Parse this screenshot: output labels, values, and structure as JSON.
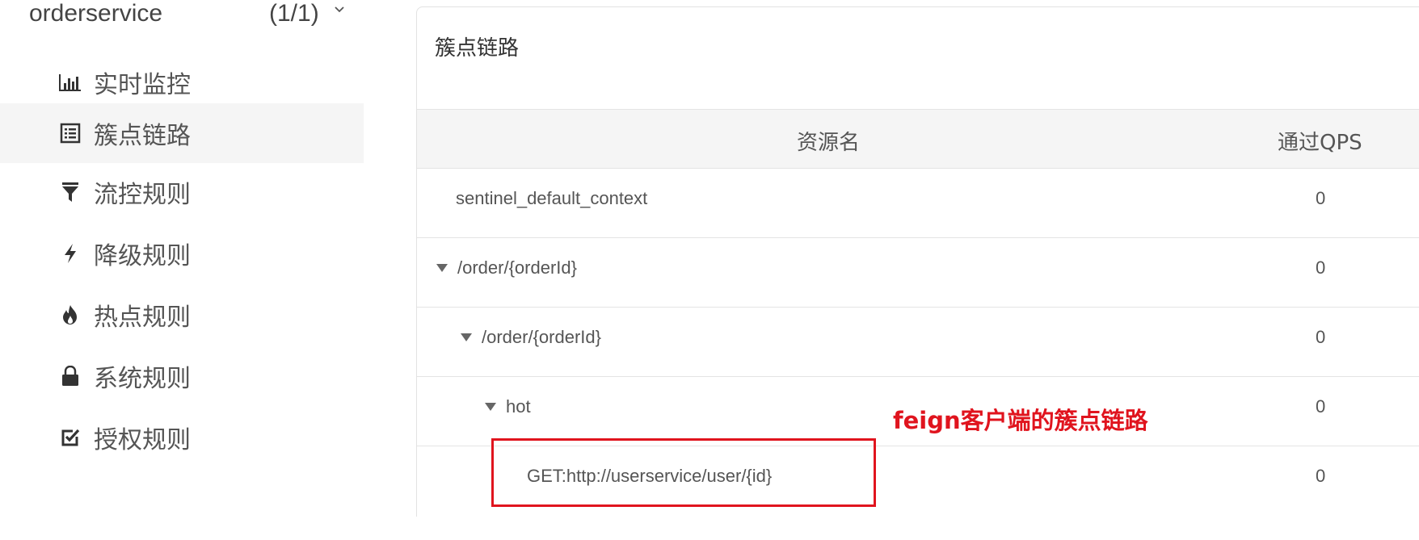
{
  "sidebar": {
    "app_name": "orderservice",
    "app_count": "(1/1)",
    "items": [
      {
        "label": "实时监控",
        "icon": "bar-chart-icon"
      },
      {
        "label": "簇点链路",
        "icon": "list-icon"
      },
      {
        "label": "流控规则",
        "icon": "filter-icon"
      },
      {
        "label": "降级规则",
        "icon": "lightning-icon"
      },
      {
        "label": "热点规则",
        "icon": "fire-icon"
      },
      {
        "label": "系统规则",
        "icon": "lock-icon"
      },
      {
        "label": "授权规则",
        "icon": "check-square-icon"
      }
    ],
    "active_index": 1
  },
  "panel": {
    "title": "簇点链路",
    "columns": {
      "resource": "资源名",
      "qps": "通过QPS"
    },
    "rows": [
      {
        "name": "sentinel_default_context",
        "qps": "0",
        "level": 0,
        "expanded": null
      },
      {
        "name": "/order/{orderId}",
        "qps": "0",
        "level": 1,
        "expanded": true
      },
      {
        "name": "/order/{orderId}",
        "qps": "0",
        "level": 2,
        "expanded": true
      },
      {
        "name": "hot",
        "qps": "0",
        "level": 3,
        "expanded": true
      },
      {
        "name": "GET:http://userservice/user/{id}",
        "qps": "0",
        "level": 4,
        "expanded": null
      }
    ]
  },
  "annotation": {
    "text": "feign客户端的簇点链路",
    "color": "#e0141e"
  }
}
